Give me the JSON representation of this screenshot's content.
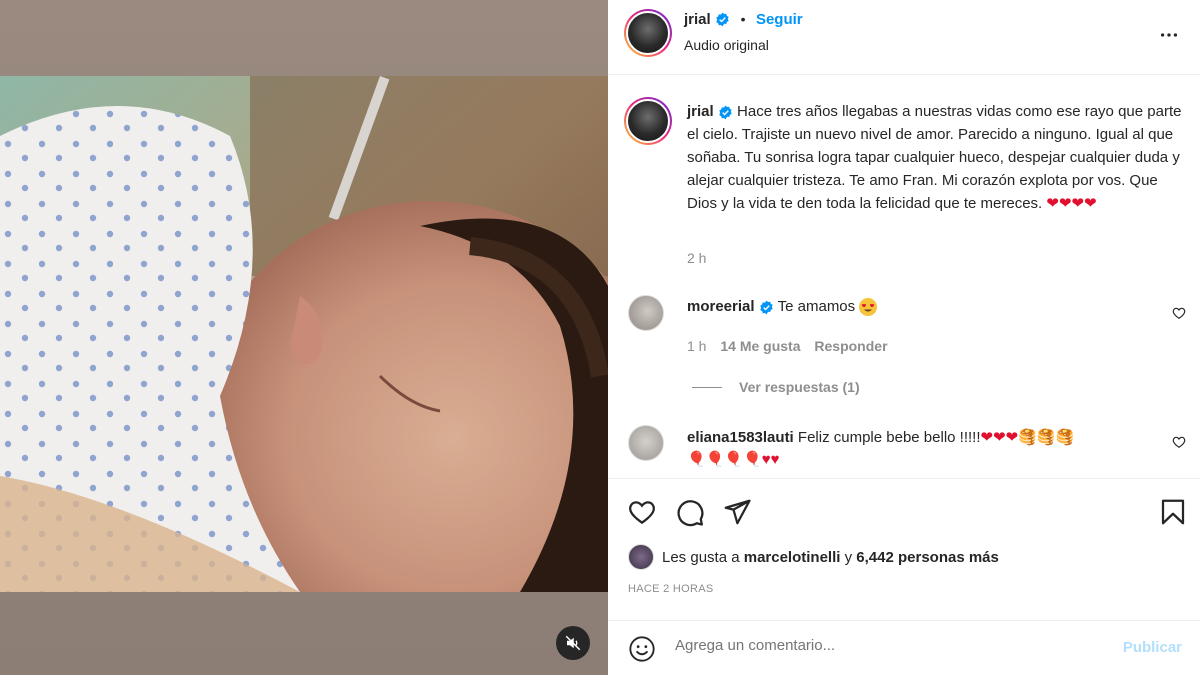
{
  "post": {
    "author": "jrial",
    "follow_label": "Seguir",
    "separator": "•",
    "audio": "Audio original"
  },
  "caption": {
    "username": "jrial",
    "text": "Hace tres años llegabas a nuestras vidas como ese rayo que parte el cielo. Trajiste un nuevo nivel de amor. Parecido a ninguno. Igual al que soñaba. Tu sonrisa logra tapar cualquier hueco, despejar cualquier duda y alejar cualquier tristeza. Te amo Fran. Mi corazón explota por vos. Que Dios y la vida te den toda la felicidad que te mereces.",
    "hearts": "❤❤❤❤",
    "time": "2 h"
  },
  "comments": [
    {
      "username": "moreerial",
      "text": "Te amamos",
      "emoji": "heart-eyes-emoji",
      "time": "1 h",
      "likes": "14 Me gusta",
      "reply_label": "Responder",
      "view_replies": "Ver respuestas (1)"
    },
    {
      "username": "eliana1583lauti",
      "text": "Feliz cumple bebe bello !!!!!",
      "line1_emoji": "❤❤❤🥞🥞🥞",
      "line2_emoji": "🎈🎈🎈🎈♥♥"
    }
  ],
  "likes_line": {
    "prefix": "Les gusta a",
    "user": "marcelotinelli",
    "connector": "y",
    "others": "6,442 personas más"
  },
  "timestamp": "HACE 2 HORAS",
  "comment_box": {
    "placeholder": "Agrega un comentario...",
    "publish": "Publicar"
  },
  "icons": {
    "like": "heart-icon",
    "comment": "comment-icon",
    "share": "share-icon",
    "save": "bookmark-icon",
    "more": "more-options-icon",
    "mute": "muted-speaker-icon",
    "emoji": "emoji-icon"
  },
  "colors": {
    "follow": "#0095f6",
    "verified": "#0095f6",
    "heart": "#e0102e",
    "publish_disabled": "#b2dffc"
  }
}
